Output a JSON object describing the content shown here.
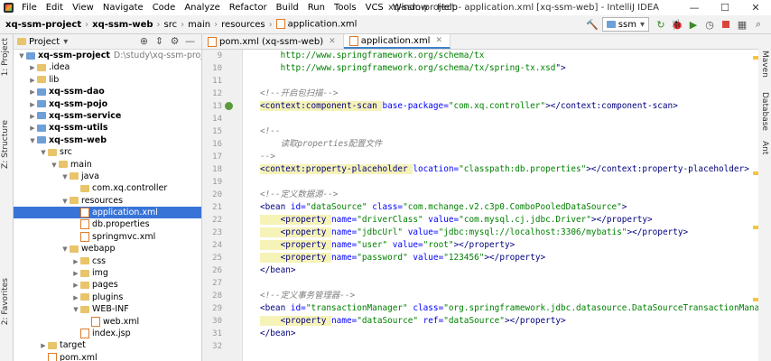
{
  "titlebar": {
    "menu": [
      "File",
      "Edit",
      "View",
      "Navigate",
      "Code",
      "Analyze",
      "Refactor",
      "Build",
      "Run",
      "Tools",
      "VCS",
      "Window",
      "Help"
    ],
    "title": "xq-ssm-project - application.xml [xq-ssm-web] - IntelliJ IDEA",
    "minimize": "—",
    "maximize": "☐",
    "close": "✕"
  },
  "breadcrumb": [
    "xq-ssm-project",
    "xq-ssm-web",
    "src",
    "main",
    "resources",
    "application.xml"
  ],
  "run_config": "ssm",
  "tool_strips": {
    "left": [
      "1: Project",
      "Z: Structure",
      "2: Favorites"
    ],
    "right": [
      "Maven",
      "Database",
      "Ant"
    ]
  },
  "project_panel": {
    "title": "Project",
    "items": [
      {
        "indent": 0,
        "arrow": "▼",
        "icon": "module",
        "label": "xq-ssm-project",
        "bold": true,
        "path": "D:\\study\\xq-ssm-project"
      },
      {
        "indent": 1,
        "arrow": "▶",
        "icon": "folder",
        "label": ".idea"
      },
      {
        "indent": 1,
        "arrow": "▶",
        "icon": "folder",
        "label": "lib"
      },
      {
        "indent": 1,
        "arrow": "▶",
        "icon": "module",
        "label": "xq-ssm-dao",
        "bold": true
      },
      {
        "indent": 1,
        "arrow": "▶",
        "icon": "module",
        "label": "xq-ssm-pojo",
        "bold": true
      },
      {
        "indent": 1,
        "arrow": "▶",
        "icon": "module",
        "label": "xq-ssm-service",
        "bold": true
      },
      {
        "indent": 1,
        "arrow": "▶",
        "icon": "module",
        "label": "xq-ssm-utils",
        "bold": true
      },
      {
        "indent": 1,
        "arrow": "▼",
        "icon": "module",
        "label": "xq-ssm-web",
        "bold": true
      },
      {
        "indent": 2,
        "arrow": "▼",
        "icon": "folder",
        "label": "src"
      },
      {
        "indent": 3,
        "arrow": "▼",
        "icon": "folder",
        "label": "main"
      },
      {
        "indent": 4,
        "arrow": "▼",
        "icon": "folder",
        "label": "java"
      },
      {
        "indent": 5,
        "arrow": "",
        "icon": "folder",
        "label": "com.xq.controller"
      },
      {
        "indent": 4,
        "arrow": "▼",
        "icon": "folder",
        "label": "resources"
      },
      {
        "indent": 5,
        "arrow": "",
        "icon": "xml",
        "label": "application.xml",
        "selected": true
      },
      {
        "indent": 5,
        "arrow": "",
        "icon": "xml",
        "label": "db.properties"
      },
      {
        "indent": 5,
        "arrow": "",
        "icon": "xml",
        "label": "springmvc.xml"
      },
      {
        "indent": 4,
        "arrow": "▼",
        "icon": "folder",
        "label": "webapp"
      },
      {
        "indent": 5,
        "arrow": "▶",
        "icon": "folder",
        "label": "css"
      },
      {
        "indent": 5,
        "arrow": "▶",
        "icon": "folder",
        "label": "img"
      },
      {
        "indent": 5,
        "arrow": "▶",
        "icon": "folder",
        "label": "pages"
      },
      {
        "indent": 5,
        "arrow": "▶",
        "icon": "folder",
        "label": "plugins"
      },
      {
        "indent": 5,
        "arrow": "▼",
        "icon": "folder",
        "label": "WEB-INF"
      },
      {
        "indent": 6,
        "arrow": "",
        "icon": "xml",
        "label": "web.xml"
      },
      {
        "indent": 5,
        "arrow": "",
        "icon": "xml",
        "label": "index.jsp"
      },
      {
        "indent": 2,
        "arrow": "▶",
        "icon": "folder",
        "label": "target"
      },
      {
        "indent": 2,
        "arrow": "",
        "icon": "xml",
        "label": "pom.xml"
      }
    ]
  },
  "tabs": [
    {
      "label": "pom.xml (xq-ssm-web)",
      "active": false
    },
    {
      "label": "application.xml",
      "active": true
    }
  ],
  "code_lines": [
    {
      "n": "9",
      "segs": [
        [
          "url",
          "    http://www.springframework.org/schema/tx"
        ]
      ]
    },
    {
      "n": "10",
      "segs": [
        [
          "url",
          "    http://www.springframework.org/schema/tx/spring-tx.xsd"
        ],
        [
          "tag",
          "\">"
        ]
      ]
    },
    {
      "n": "11",
      "segs": []
    },
    {
      "n": "12",
      "segs": [
        [
          "cmt",
          "<!--开启包扫描-->"
        ]
      ]
    },
    {
      "n": "13",
      "marker": true,
      "segs": [
        [
          "tag",
          "<context:component-scan "
        ],
        [
          "attr",
          "base-package="
        ],
        [
          "val",
          "\"com.xq.controller\""
        ],
        [
          "tag",
          "></context:component-scan>"
        ]
      ],
      "hl": true
    },
    {
      "n": "14",
      "segs": []
    },
    {
      "n": "15",
      "segs": [
        [
          "cmt",
          "<!--"
        ]
      ]
    },
    {
      "n": "16",
      "segs": [
        [
          "cmt",
          "    读取properties配置文件"
        ]
      ]
    },
    {
      "n": "17",
      "segs": [
        [
          "cmt",
          "-->"
        ]
      ]
    },
    {
      "n": "18",
      "segs": [
        [
          "tag",
          "<context:property-placeholder "
        ],
        [
          "attr",
          "location="
        ],
        [
          "val",
          "\"classpath:db.properties\""
        ],
        [
          "tag",
          "></context:property-placeholder>"
        ]
      ],
      "hl": true
    },
    {
      "n": "19",
      "segs": []
    },
    {
      "n": "20",
      "segs": [
        [
          "cmt",
          "<!--定义数据源-->"
        ]
      ]
    },
    {
      "n": "21",
      "segs": [
        [
          "tag",
          "<bean "
        ],
        [
          "attr",
          "id="
        ],
        [
          "val",
          "\"dataSource\" "
        ],
        [
          "attr",
          "class="
        ],
        [
          "val",
          "\"com.mchange.v2.c3p0.ComboPooledDataSource\""
        ],
        [
          "tag",
          ">"
        ]
      ]
    },
    {
      "n": "22",
      "segs": [
        [
          "tag",
          "    <property "
        ],
        [
          "attr",
          "name="
        ],
        [
          "val",
          "\"driverClass\" "
        ],
        [
          "attr",
          "value="
        ],
        [
          "val",
          "\"com.mysql.cj.jdbc.Driver\""
        ],
        [
          "tag",
          "></property>"
        ]
      ],
      "hl": true
    },
    {
      "n": "23",
      "segs": [
        [
          "tag",
          "    <property "
        ],
        [
          "attr",
          "name="
        ],
        [
          "val",
          "\"jdbcUrl\" "
        ],
        [
          "attr",
          "value="
        ],
        [
          "val",
          "\"jdbc:mysql://localhost:3306/mybatis\""
        ],
        [
          "tag",
          "></property>"
        ]
      ],
      "hl": true
    },
    {
      "n": "24",
      "segs": [
        [
          "tag",
          "    <property "
        ],
        [
          "attr",
          "name="
        ],
        [
          "val",
          "\"user\" "
        ],
        [
          "attr",
          "value="
        ],
        [
          "val",
          "\"root\""
        ],
        [
          "tag",
          "></property>"
        ]
      ],
      "hl": true
    },
    {
      "n": "25",
      "segs": [
        [
          "tag",
          "    <property "
        ],
        [
          "attr",
          "name="
        ],
        [
          "val",
          "\"password\" "
        ],
        [
          "attr",
          "value="
        ],
        [
          "val",
          "\"123456\""
        ],
        [
          "tag",
          "></property>"
        ]
      ],
      "hl": true
    },
    {
      "n": "26",
      "segs": [
        [
          "tag",
          "</bean>"
        ]
      ]
    },
    {
      "n": "27",
      "segs": []
    },
    {
      "n": "28",
      "segs": [
        [
          "cmt",
          "<!--定义事务管理器-->"
        ]
      ]
    },
    {
      "n": "29",
      "segs": [
        [
          "tag",
          "<bean "
        ],
        [
          "attr",
          "id="
        ],
        [
          "val",
          "\"transactionManager\" "
        ],
        [
          "attr",
          "class="
        ],
        [
          "val",
          "\"org.springframework.jdbc.datasource.DataSourceTransactionManager\""
        ],
        [
          "tag",
          ">"
        ]
      ]
    },
    {
      "n": "30",
      "segs": [
        [
          "tag",
          "    <property "
        ],
        [
          "attr",
          "name="
        ],
        [
          "val",
          "\"dataSource\" "
        ],
        [
          "attr",
          "ref="
        ],
        [
          "val",
          "\"dataSource\""
        ],
        [
          "tag",
          "></property>"
        ]
      ],
      "hl": true
    },
    {
      "n": "31",
      "segs": [
        [
          "tag",
          "</bean>"
        ]
      ]
    },
    {
      "n": "32",
      "segs": []
    }
  ]
}
